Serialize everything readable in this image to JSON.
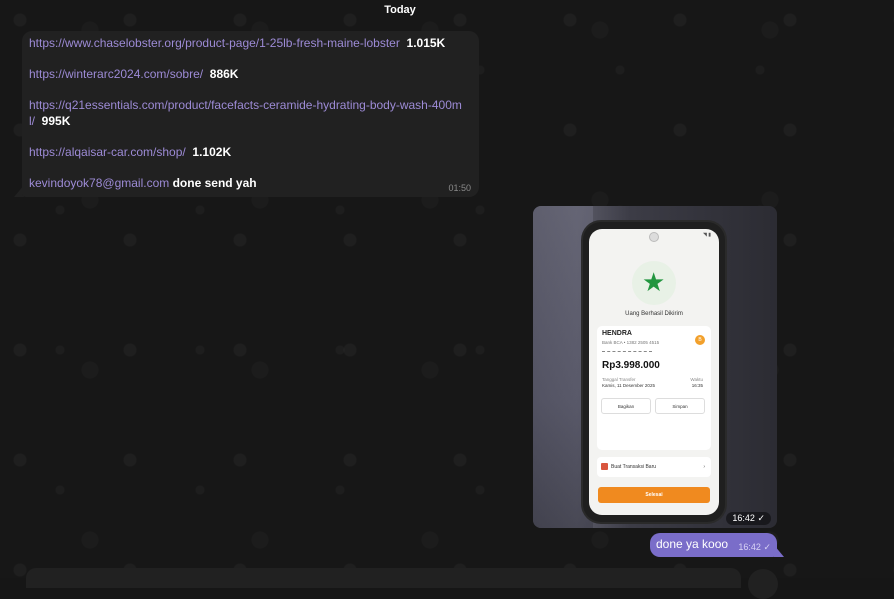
{
  "chat": {
    "date_label": "Today",
    "incoming": {
      "lines": [
        {
          "link": "https://www.chaselobster.org/product-page/1-25lb-fresh-maine-lobster",
          "value": "1.015K"
        },
        {
          "link": "https://winterarc2024.com/sobre/",
          "value": "886K"
        },
        {
          "link": "https://q21essentials.com/product/facefacts-ceramide-hydrating-body-wash-400ml/",
          "value": "995K"
        },
        {
          "link": "https://alqaisar-car.com/shop/",
          "value": "1.102K"
        },
        {
          "link": "kevindoyok78@gmail.com",
          "value": "done send yah"
        }
      ],
      "time": "01:50"
    },
    "photo_message": {
      "time": "16:42",
      "check": "✓",
      "screen": {
        "title": "Uang Berhasil Dikirim",
        "recipient_name": "HENDRA",
        "recipient_bank": "Bank BCA • 1382 2505 4515",
        "bank_badge": "BCA",
        "amount": "Rp3.998.000",
        "date_label": "Tanggal Transfer",
        "date_value": "Kamis, 11 Desember 2025",
        "time_label": "Waktu",
        "time_value": "16:35",
        "share_label": "Bagikan",
        "save_label": "Simpan",
        "make_new_label": "Buat Transaksi Baru",
        "done_label": "Selesai"
      }
    },
    "outgoing": {
      "text": "done ya kooo",
      "time": "16:42",
      "check": "✓"
    }
  },
  "colors": {
    "background": "#171717",
    "incoming_bubble": "#212121",
    "outgoing_bubble": "#7a6dc9",
    "link": "#9d8bd6"
  },
  "icons": {
    "success": "star-check-icon",
    "read_receipt": "check-icon"
  }
}
